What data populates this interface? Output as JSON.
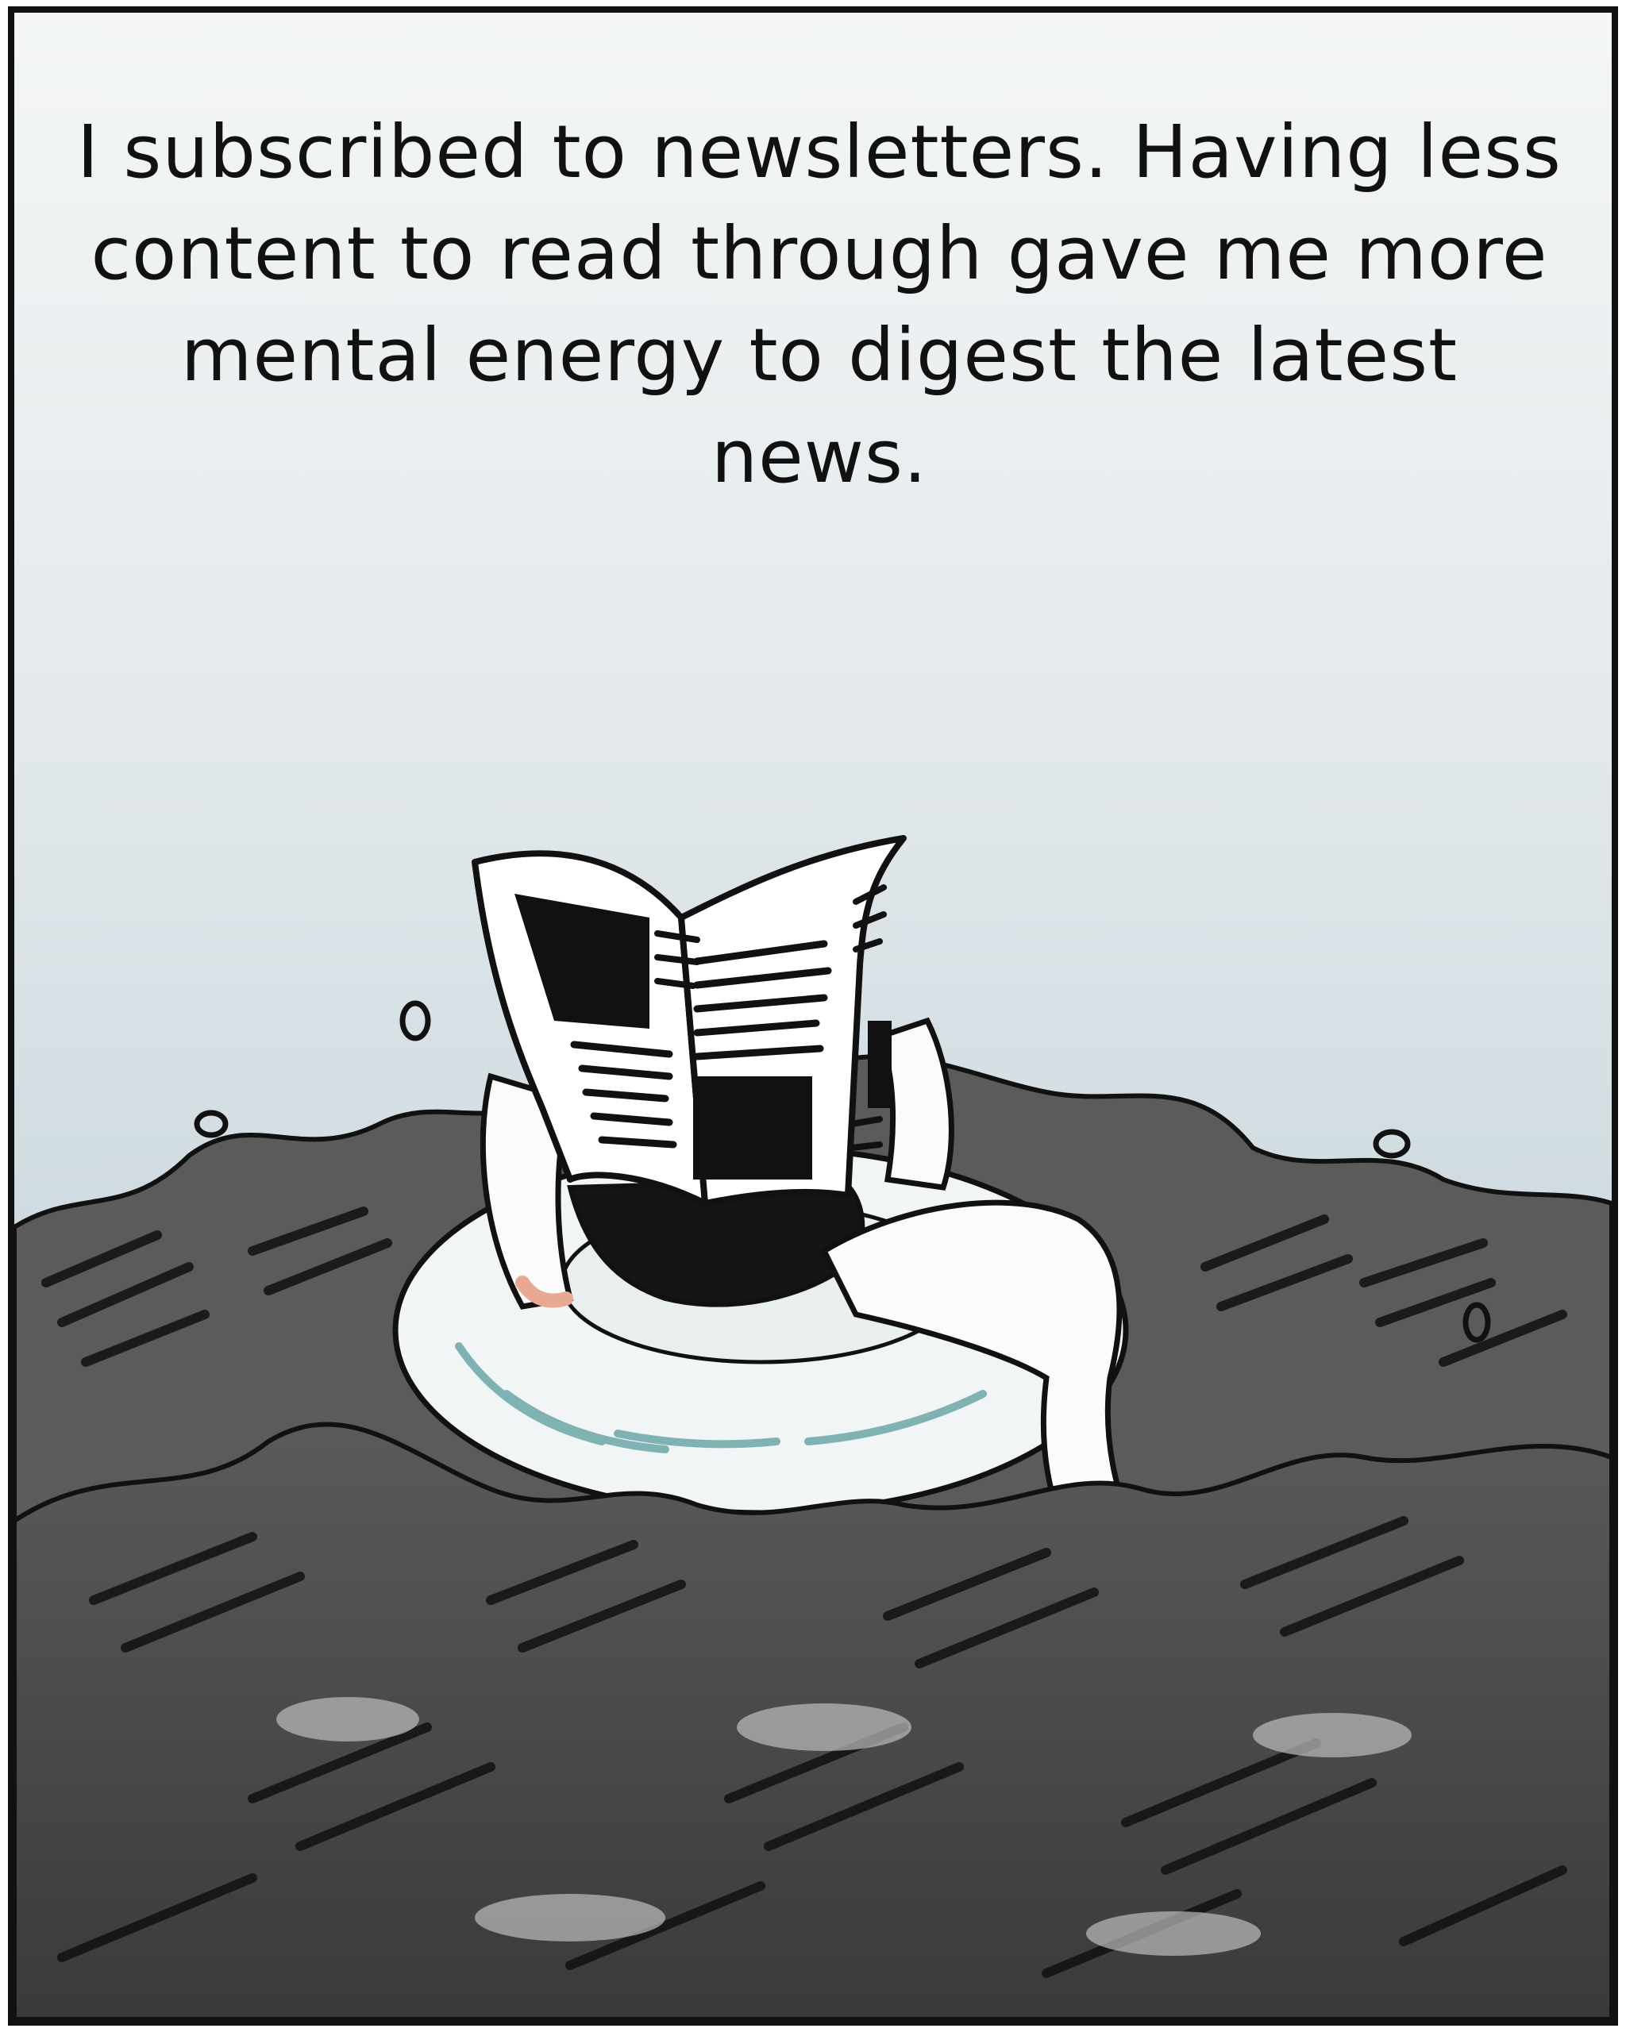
{
  "caption": {
    "text": "I subscribed to newsletters. Having less content to read through gave me more mental energy to digest the latest news."
  },
  "colors": {
    "sky_top": "#f4f6f6",
    "sky_bottom": "#b9c9d1",
    "sea_dark": "#3c3c3c",
    "sea_mid": "#8e8e8e",
    "sea_light": "#bdbdbd",
    "ink": "#111111",
    "skin_shade": "#e9a892",
    "float_tint": "#7fb2b3",
    "paper": "#ffffff"
  },
  "icons": [
    "newspaper-icon",
    "swim-ring-icon"
  ]
}
